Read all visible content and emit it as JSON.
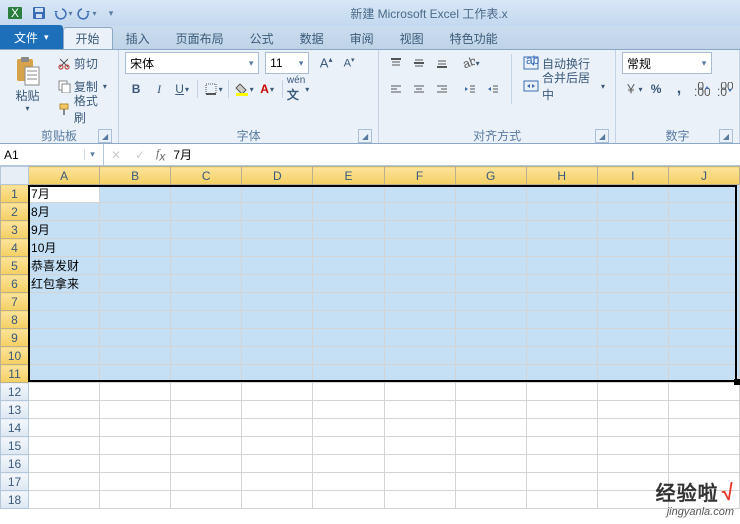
{
  "window_title": "新建 Microsoft Excel 工作表.x",
  "qat": {
    "save": "保存",
    "undo": "撤销",
    "redo": "恢复"
  },
  "tabs": {
    "file": "文件",
    "items": [
      "开始",
      "插入",
      "页面布局",
      "公式",
      "数据",
      "审阅",
      "视图",
      "特色功能"
    ],
    "active_index": 0
  },
  "ribbon": {
    "clipboard": {
      "label": "剪贴板",
      "paste": "粘贴",
      "cut": "剪切",
      "copy": "复制",
      "format_painter": "格式刷"
    },
    "font": {
      "label": "字体",
      "name": "宋体",
      "size": "11"
    },
    "alignment": {
      "label": "对齐方式",
      "wrap": "自动换行",
      "merge": "合并后居中"
    },
    "number": {
      "label": "数字",
      "format": "常规"
    }
  },
  "namebox": "A1",
  "formula": "7月",
  "columns": [
    "A",
    "B",
    "C",
    "D",
    "E",
    "F",
    "G",
    "H",
    "I",
    "J"
  ],
  "rows": [
    1,
    2,
    3,
    4,
    5,
    6,
    7,
    8,
    9,
    10,
    11,
    12,
    13,
    14,
    15,
    16,
    17,
    18
  ],
  "selection": {
    "r1": 1,
    "c1": 1,
    "r2": 11,
    "c2": 10,
    "active_r": 1,
    "active_c": 1
  },
  "cells": {
    "1": {
      "1": "7月"
    },
    "2": {
      "1": "8月"
    },
    "3": {
      "1": "9月"
    },
    "4": {
      "1": "10月"
    },
    "5": {
      "1": "恭喜发财"
    },
    "6": {
      "1": "红包拿来"
    }
  },
  "watermark": {
    "brand": "经验啦",
    "check": "√",
    "url": "jingyanla.com"
  }
}
